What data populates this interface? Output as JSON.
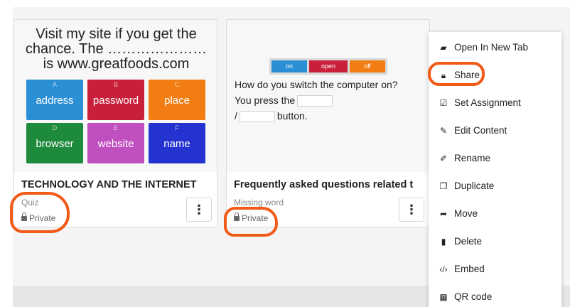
{
  "cards": [
    {
      "thumbnail": {
        "question": "Visit my site if you get the chance. The ………………… is www.greatfoods.com",
        "tiles": [
          {
            "letter": "A",
            "text": "address",
            "color": "#2b8fd6"
          },
          {
            "letter": "B",
            "text": "password",
            "color": "#c8203a"
          },
          {
            "letter": "C",
            "text": "place",
            "color": "#f27d12"
          },
          {
            "letter": "D",
            "text": "browser",
            "color": "#1e8a3c"
          },
          {
            "letter": "E",
            "text": "website",
            "color": "#c04fc0"
          },
          {
            "letter": "F",
            "text": "name",
            "color": "#2433d0"
          }
        ]
      },
      "title": "TECHNOLOGY AND THE INTERNET",
      "type": "Quiz",
      "privacy": "Private",
      "menu_icon": "vertical-dots-icon"
    },
    {
      "thumbnail": {
        "toggles": [
          "on",
          "open",
          "off"
        ],
        "question": "How do you switch the computer on?",
        "line2_prefix": "You press the",
        "line3_prefix": "/",
        "line3_suffix": "button."
      },
      "title": "Frequently asked questions related t",
      "type": "Missing word",
      "privacy": "Private",
      "menu_icon": "vertical-dots-icon"
    }
  ],
  "context_menu": {
    "items": [
      {
        "label": "Open In New Tab",
        "icon": "folder-open-icon"
      },
      {
        "label": "Share",
        "icon": "lock-icon"
      },
      {
        "label": "Set Assignment",
        "icon": "checkbox-icon"
      },
      {
        "label": "Edit Content",
        "icon": "pencil-icon"
      },
      {
        "label": "Rename",
        "icon": "edit-box-icon"
      },
      {
        "label": "Duplicate",
        "icon": "copy-icon"
      },
      {
        "label": "Move",
        "icon": "folder-move-icon"
      },
      {
        "label": "Delete",
        "icon": "trash-icon"
      },
      {
        "label": "Embed",
        "icon": "code-icon"
      },
      {
        "label": "QR code",
        "icon": "qr-code-icon"
      }
    ]
  },
  "colors": {
    "highlight": "#f25a17",
    "tile_blue": "#2b8fd6",
    "tile_red": "#c8203a",
    "tile_orange": "#f27d12",
    "tile_green": "#1e8a3c",
    "tile_purple": "#c04fc0",
    "tile_navy": "#2433d0"
  }
}
